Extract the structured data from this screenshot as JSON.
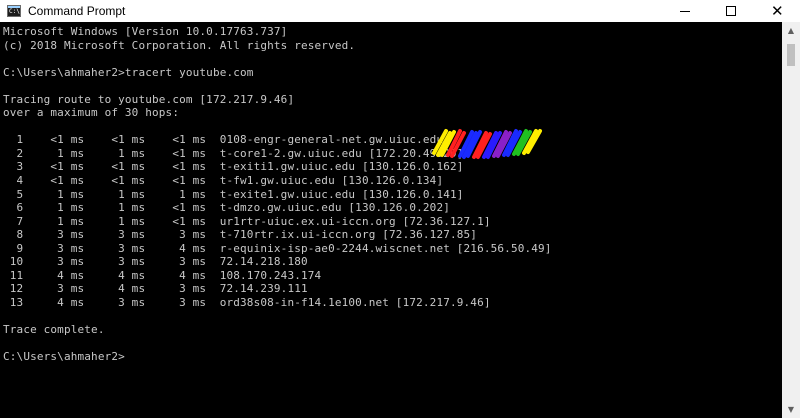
{
  "window": {
    "title": "Command Prompt",
    "minimize_glyph": "",
    "close_glyph": "✕"
  },
  "console": {
    "lines": [
      "Microsoft Windows [Version 10.0.17763.737]",
      "(c) 2018 Microsoft Corporation. All rights reserved.",
      "",
      "C:\\Users\\ahmaher2>tracert youtube.com",
      "",
      "Tracing route to youtube.com [172.217.9.46]",
      "over a maximum of 30 hops:",
      "",
      "  1    <1 ms    <1 ms    <1 ms  0108-engr-general-net.gw.uiuc.edu",
      "  2     1 ms     1 ms    <1 ms  t-core1-2.gw.uiuc.edu [172.20.49.29]",
      "  3    <1 ms    <1 ms    <1 ms  t-exiti1.gw.uiuc.edu [130.126.0.162]",
      "  4    <1 ms    <1 ms    <1 ms  t-fw1.gw.uiuc.edu [130.126.0.134]",
      "  5     1 ms     1 ms     1 ms  t-exite1.gw.uiuc.edu [130.126.0.141]",
      "  6     1 ms     1 ms    <1 ms  t-dmzo.gw.uiuc.edu [130.126.0.202]",
      "  7     1 ms     1 ms    <1 ms  ur1rtr-uiuc.ex.ui-iccn.org [72.36.127.1]",
      "  8     3 ms     3 ms     3 ms  t-710rtr.ix.ui-iccn.org [72.36.127.85]",
      "  9     3 ms     3 ms     4 ms  r-equinix-isp-ae0-2244.wiscnet.net [216.56.50.49]",
      " 10     3 ms     3 ms     3 ms  72.14.218.180",
      " 11     4 ms     4 ms     4 ms  108.170.243.174",
      " 12     3 ms     4 ms     3 ms  72.14.239.111",
      " 13     4 ms     3 ms     3 ms  ord38s08-in-f14.1e100.net [172.217.9.46]",
      "",
      "Trace complete.",
      "",
      "C:\\Users\\ahmaher2>"
    ],
    "text_color": "#c8c8c8",
    "background": "#000000"
  },
  "scrollbar": {
    "up_glyph": "▲",
    "down_glyph": "▼"
  }
}
